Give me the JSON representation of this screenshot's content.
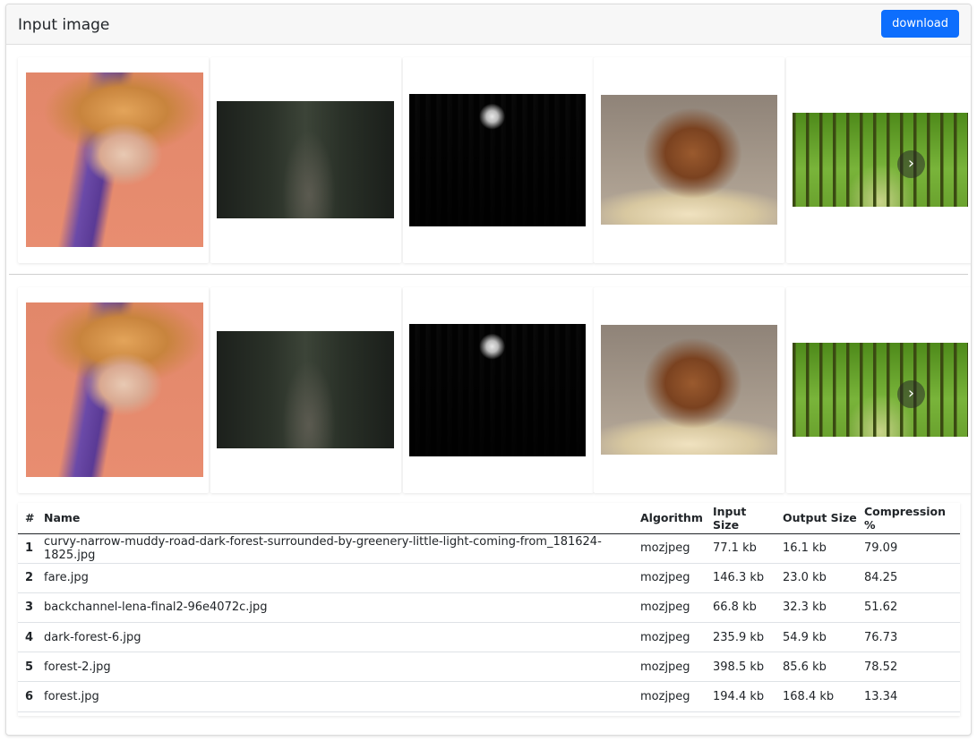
{
  "header": {
    "title": "Input image",
    "download_label": "download"
  },
  "colors": {
    "accent": "#0d6efd",
    "header_bg": "#f7f7f7"
  },
  "carousels": [
    {
      "name": "input",
      "images": [
        "lena",
        "road",
        "moon-forest",
        "mouse",
        "green-forest"
      ],
      "next_icon": "chevron-right-icon",
      "next_glyph": "›"
    },
    {
      "name": "output",
      "images": [
        "lena",
        "road",
        "moon-forest",
        "mouse",
        "green-forest"
      ],
      "next_icon": "chevron-right-icon",
      "next_glyph": "›"
    }
  ],
  "table": {
    "headers": [
      "#",
      "Name",
      "Algorithm",
      "Input Size",
      "Output Size",
      "Compression %"
    ],
    "rows": [
      [
        "1",
        "curvy-narrow-muddy-road-dark-forest-surrounded-by-greenery-little-light-coming-from_181624-1825.jpg",
        "mozjpeg",
        "77.1 kb",
        "16.1 kb",
        "79.09"
      ],
      [
        "2",
        "fare.jpg",
        "mozjpeg",
        "146.3 kb",
        "23.0 kb",
        "84.25"
      ],
      [
        "3",
        "backchannel-lena-final2-96e4072c.jpg",
        "mozjpeg",
        "66.8 kb",
        "32.3 kb",
        "51.62"
      ],
      [
        "4",
        "dark-forest-6.jpg",
        "mozjpeg",
        "235.9 kb",
        "54.9 kb",
        "76.73"
      ],
      [
        "5",
        "forest-2.jpg",
        "mozjpeg",
        "398.5 kb",
        "85.6 kb",
        "78.52"
      ],
      [
        "6",
        "forest.jpg",
        "mozjpeg",
        "194.4 kb",
        "168.4 kb",
        "13.34"
      ]
    ]
  }
}
